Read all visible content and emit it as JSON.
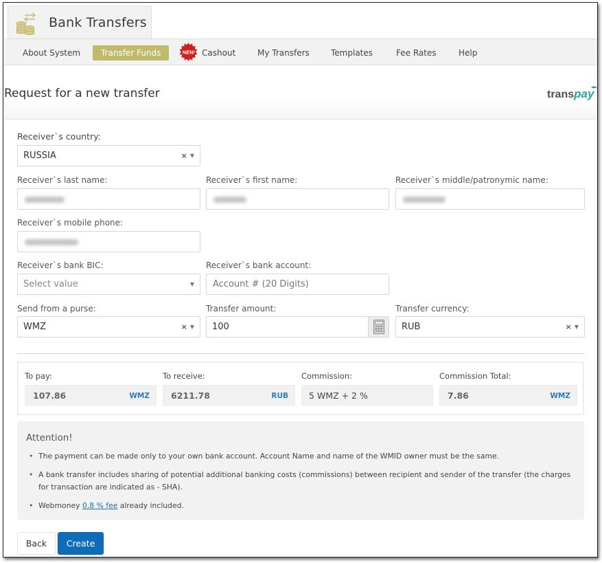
{
  "app": {
    "title": "Bank Transfers"
  },
  "nav": {
    "items": [
      {
        "label": "About System",
        "active": false
      },
      {
        "label": "Transfer Funds",
        "active": true
      },
      {
        "label": "Cashout",
        "active": false,
        "badge": "NEW"
      },
      {
        "label": "My Transfers",
        "active": false
      },
      {
        "label": "Templates",
        "active": false
      },
      {
        "label": "Fee Rates",
        "active": false
      },
      {
        "label": "Help",
        "active": false
      }
    ]
  },
  "page": {
    "title": "Request for a new transfer",
    "brand_part1": "trans",
    "brand_part2": "pay"
  },
  "form": {
    "country": {
      "label": "Receiver`s country:",
      "value": "RUSSIA"
    },
    "last_name": {
      "label": "Receiver`s last name:",
      "value": "(blurred)"
    },
    "first_name": {
      "label": "Receiver`s first name:",
      "value": "(blurred)"
    },
    "middle_name": {
      "label": "Receiver`s middle/patronymic name:",
      "value": "(blurred)"
    },
    "mobile_phone": {
      "label": "Receiver`s mobile phone:",
      "value": "(blurred)"
    },
    "bank_bic": {
      "label": "Receiver`s bank BIC:",
      "placeholder": "Select value"
    },
    "bank_account": {
      "label": "Receiver`s bank account:",
      "placeholder": "Account # (20 Digits)"
    },
    "purse": {
      "label": "Send from a purse:",
      "value": "WMZ"
    },
    "amount": {
      "label": "Transfer amount:",
      "value": "100"
    },
    "currency": {
      "label": "Transfer currency:",
      "value": "RUB"
    }
  },
  "summary": {
    "to_pay": {
      "label": "To pay:",
      "value": "107.86",
      "currency": "WMZ"
    },
    "to_receive": {
      "label": "To receive:",
      "value": "6211.78",
      "currency": "RUB"
    },
    "commission": {
      "label": "Commission:",
      "value": "5 WMZ + 2 %"
    },
    "commission_total": {
      "label": "Commission Total:",
      "value": "7.86",
      "currency": "WMZ"
    }
  },
  "attention": {
    "title": "Attention!",
    "items": [
      "The payment can be made only to your own bank account. Account Name and name of the WMID owner must be the same.",
      "A bank transfer includes sharing of potential additional banking costs (commissions) between recipient and sender of the transfer (the charges for transaction are indicated as - SHA)."
    ],
    "fee_prefix": "Webmoney ",
    "fee_link": "0.8 % fee",
    "fee_suffix": " already included."
  },
  "buttons": {
    "back": "Back",
    "create": "Create"
  },
  "colors": {
    "accent": "#c0bb6a",
    "primary_button": "#0f6db8",
    "currency_label": "#2b7bbf",
    "new_badge": "#d0201e",
    "brand_teal": "#29a0a3"
  }
}
